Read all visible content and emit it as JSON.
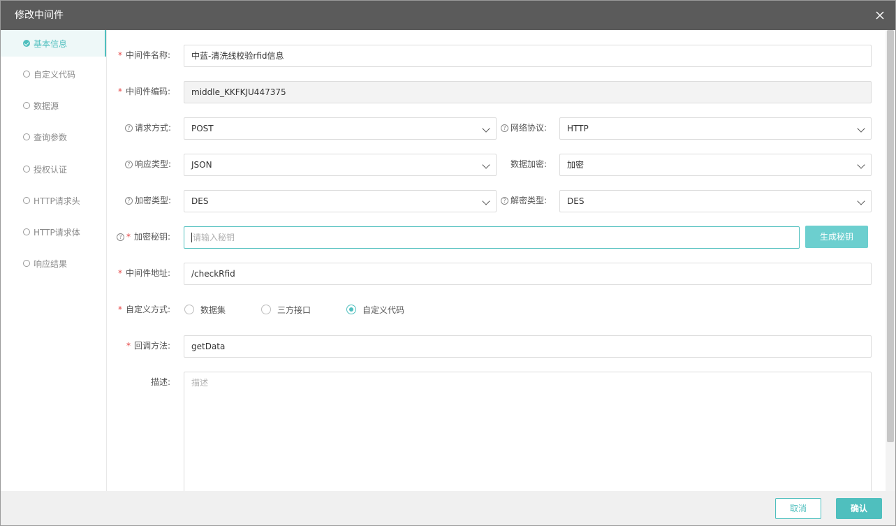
{
  "dialog": {
    "title": "修改中间件",
    "accent": "#4fbfbe"
  },
  "sidebar": {
    "items": [
      {
        "label": "基本信息",
        "active": true
      },
      {
        "label": "自定义代码"
      },
      {
        "label": "数据源"
      },
      {
        "label": "查询参数"
      },
      {
        "label": "授权认证"
      },
      {
        "label": "HTTP请求头"
      },
      {
        "label": "HTTP请求体"
      },
      {
        "label": "响应结果"
      }
    ]
  },
  "form": {
    "req_mark": "*",
    "help_mark": "?",
    "name_label": "中间件名称:",
    "name_value": "中蓝-清洗线校验rfid信息",
    "code_label": "中间件编码:",
    "code_value": "middle_KKFKJU447375",
    "method_label": "请求方式:",
    "method_value": "POST",
    "protocol_label": "网络协议:",
    "protocol_value": "HTTP",
    "resp_type_label": "响应类型:",
    "resp_type_value": "JSON",
    "encrypt_label": "数据加密:",
    "encrypt_value": "加密",
    "enc_type_label": "加密类型:",
    "enc_type_value": "DES",
    "dec_type_label": "解密类型:",
    "dec_type_value": "DES",
    "secret_label": "加密秘钥:",
    "secret_placeholder": "请输入秘钥",
    "gen_button": "生成秘钥",
    "address_label": "中间件地址:",
    "address_value": "/checkRfid",
    "custom_label": "自定义方式:",
    "custom_options": [
      "数据集",
      "三方接口",
      "自定义代码"
    ],
    "custom_selected": "自定义代码",
    "callback_label": "回调方法:",
    "callback_value": "getData",
    "desc_label": "描述:",
    "desc_placeholder": "描述"
  },
  "footer": {
    "cancel": "取消",
    "confirm": "确认"
  }
}
